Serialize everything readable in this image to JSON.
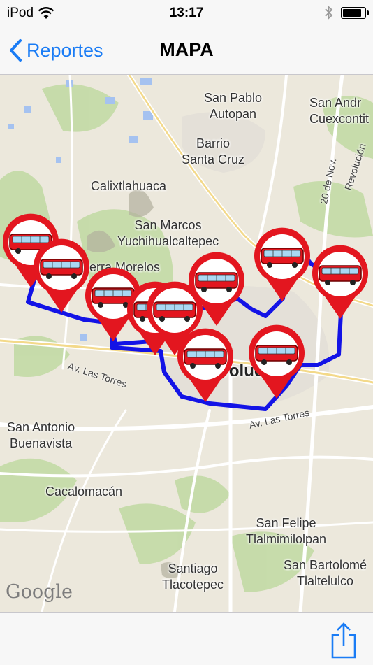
{
  "status_bar": {
    "carrier": "iPod",
    "time": "13:17"
  },
  "nav": {
    "back_label": "Reportes",
    "title": "MAPA"
  },
  "map": {
    "places": [
      {
        "id": "san-pablo",
        "text": "San Pablo\nAutopan"
      },
      {
        "id": "san-andres",
        "text": "San Andr\nCuexcontit"
      },
      {
        "id": "barrio",
        "text": "Barrio\nSanta Cruz"
      },
      {
        "id": "calixtlahuaca",
        "text": "Calixtlahuaca"
      },
      {
        "id": "san-marcos",
        "text": "San Marcos\nYuchihualcaltepec"
      },
      {
        "id": "sierra-morelos",
        "text": "Sierra Morelos"
      },
      {
        "id": "toluca",
        "text": "Toluca"
      },
      {
        "id": "san-antonio",
        "text": "San Antonio\nBuenavista"
      },
      {
        "id": "cacalomacan",
        "text": "Cacalomacán"
      },
      {
        "id": "san-felipe",
        "text": "San Felipe\nTlalmimilolpan"
      },
      {
        "id": "santiago",
        "text": "Santiago\nTlacotepec"
      },
      {
        "id": "san-bartolome",
        "text": "San Bartolomé\nTlaltelulco"
      }
    ],
    "roads": [
      {
        "id": "torres-west",
        "text": "Av. Las Torres"
      },
      {
        "id": "torres-east",
        "text": "Av. Las Torres"
      },
      {
        "id": "20nov",
        "text": "20 de Nov."
      },
      {
        "id": "revolucion",
        "text": "Revolución"
      }
    ],
    "attribution": "Google",
    "marker_icon": "bus-pin-icon",
    "route_color": "#1313e6",
    "marker_color": "#e3161f",
    "bus_stop_count": 10
  },
  "toolbar": {
    "share_icon": "share-icon"
  }
}
